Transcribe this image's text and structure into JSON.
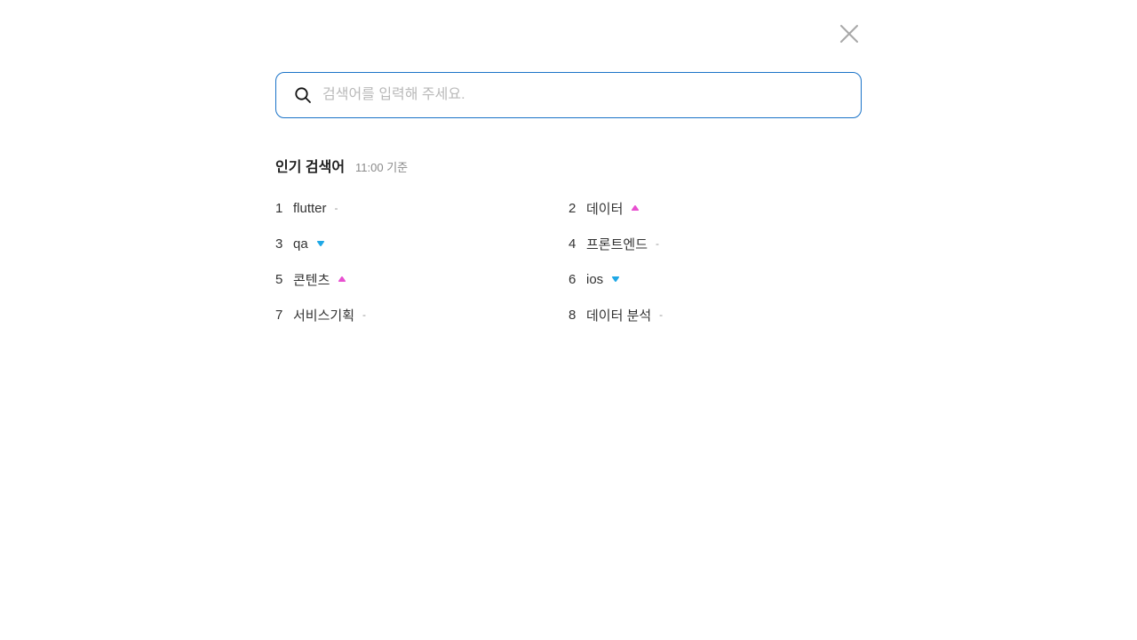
{
  "search": {
    "placeholder": "검색어를 입력해 주세요.",
    "value": "",
    "border_color": "#1a73c8"
  },
  "close_icon": "close-icon",
  "popular": {
    "title": "인기 검색어",
    "time_label": "11:00 기준",
    "items": [
      {
        "rank": "1",
        "keyword": "flutter",
        "trend": "same",
        "trend_label": "-"
      },
      {
        "rank": "2",
        "keyword": "데이터",
        "trend": "up",
        "trend_label": ""
      },
      {
        "rank": "3",
        "keyword": "qa",
        "trend": "down",
        "trend_label": ""
      },
      {
        "rank": "4",
        "keyword": "프론트엔드",
        "trend": "same",
        "trend_label": "-"
      },
      {
        "rank": "5",
        "keyword": "콘텐츠",
        "trend": "up",
        "trend_label": ""
      },
      {
        "rank": "6",
        "keyword": "ios",
        "trend": "down",
        "trend_label": ""
      },
      {
        "rank": "7",
        "keyword": "서비스기획",
        "trend": "same",
        "trend_label": "-"
      },
      {
        "rank": "8",
        "keyword": "데이터 분석",
        "trend": "same",
        "trend_label": "-"
      }
    ],
    "colors": {
      "up": "#e84fd0",
      "down": "#1fa8e6",
      "same": "#9a9a9a"
    }
  }
}
